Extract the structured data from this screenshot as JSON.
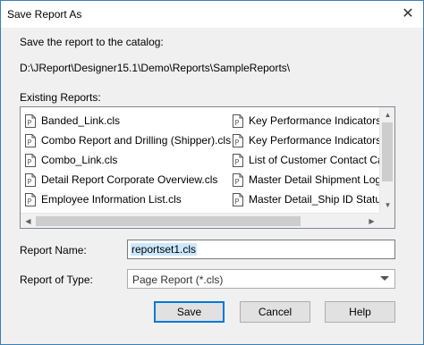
{
  "window": {
    "title": "Save Report As"
  },
  "intro_label": "Save the report to the catalog:",
  "catalog_path": "D:\\JReport\\Designer15.1\\Demo\\Reports\\SampleReports\\",
  "existing_label": "Existing Reports:",
  "reports_col1": [
    "Banded_Link.cls",
    "Combo Report and Drilling (Shipper).cls",
    "Combo_Link.cls",
    "Detail Report Corporate Overview.cls",
    "Employee Information List.cls"
  ],
  "reports_col2": [
    "Key Performance Indicators Re",
    "Key Performance Indicators_De",
    "List of Customer Contact Cards",
    "Master Detail Shipment Log.cls",
    "Master Detail_Ship ID Status (D"
  ],
  "report_name": {
    "label": "Report Name:",
    "value": "reportset1.cls"
  },
  "report_type": {
    "label": "Report of Type:",
    "value": "Page Report (*.cls)"
  },
  "buttons": {
    "save": "Save",
    "cancel": "Cancel",
    "help": "Help"
  }
}
